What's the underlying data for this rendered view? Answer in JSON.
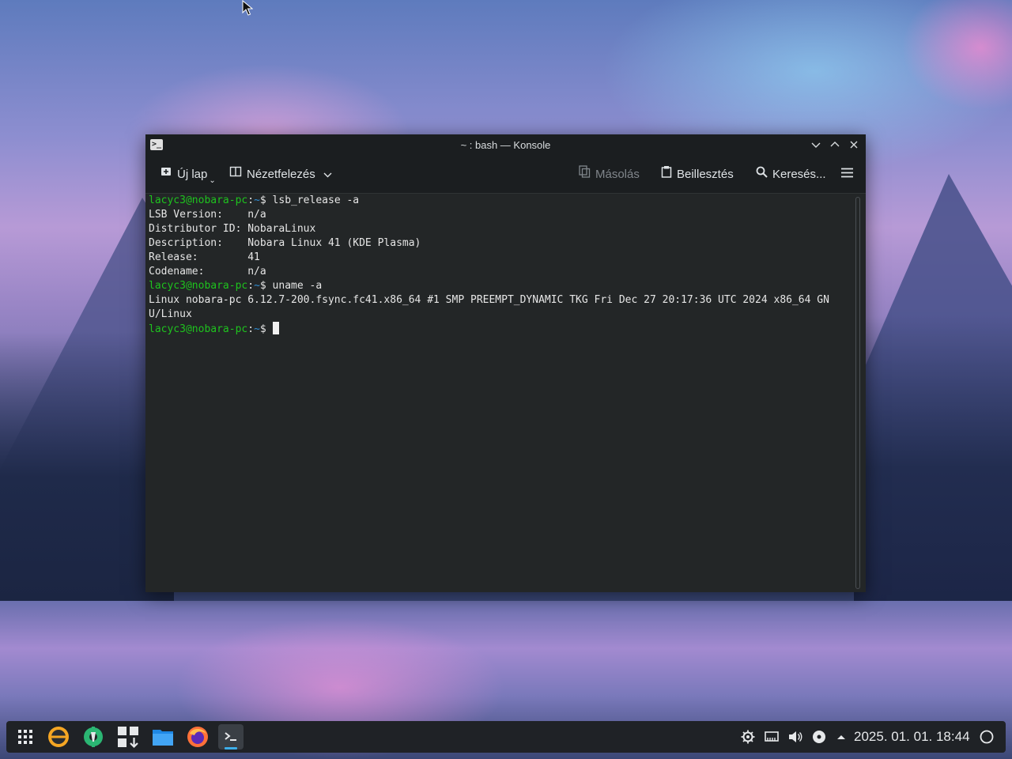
{
  "window": {
    "title": "~ : bash — Konsole",
    "controls": {
      "minimize": "⌄",
      "maximize": "⌃",
      "close": "✕"
    }
  },
  "toolbar": {
    "new_tab": "Új lap",
    "split_view": "Nézetfelezés",
    "copy": "Másolás",
    "paste": "Beillesztés",
    "search": "Keresés..."
  },
  "terminal": {
    "prompt_user": "lacyc3@nobara-pc",
    "prompt_colon": ":",
    "prompt_path": "~",
    "prompt_sign": "$ ",
    "lines": [
      {
        "type": "prompt",
        "command": "lsb_release -a"
      },
      {
        "type": "output",
        "text": "LSB Version:    n/a"
      },
      {
        "type": "output",
        "text": "Distributor ID: NobaraLinux"
      },
      {
        "type": "output",
        "text": "Description:    Nobara Linux 41 (KDE Plasma)"
      },
      {
        "type": "output",
        "text": "Release:        41"
      },
      {
        "type": "output",
        "text": "Codename:       n/a"
      },
      {
        "type": "prompt",
        "command": "uname -a"
      },
      {
        "type": "output",
        "text": "Linux nobara-pc 6.12.7-200.fsync.fc41.x86_64 #1 SMP PREEMPT_DYNAMIC TKG Fri Dec 27 20:17:36 UTC 2024 x86_64 GN"
      },
      {
        "type": "output",
        "text": "U/Linux"
      },
      {
        "type": "prompt",
        "command": "",
        "cursor": true
      }
    ]
  },
  "taskbar": {
    "launchers": [
      {
        "name": "app-launcher-icon"
      },
      {
        "name": "nobara-welcome-icon"
      },
      {
        "name": "settings-tool-icon"
      },
      {
        "name": "software-center-icon"
      },
      {
        "name": "file-manager-icon"
      },
      {
        "name": "firefox-icon"
      },
      {
        "name": "konsole-icon",
        "active": true
      }
    ],
    "tray": [
      "settings-icon",
      "network-icon",
      "volume-icon",
      "media-icon",
      "expand-tray-icon"
    ],
    "clock": "2025. 01. 01. 18:44"
  },
  "colors": {
    "prompt_user": "#1ec31e",
    "prompt_path": "#2f8ed6",
    "terminal_bg": "#232627",
    "accent": "#3daee9"
  }
}
